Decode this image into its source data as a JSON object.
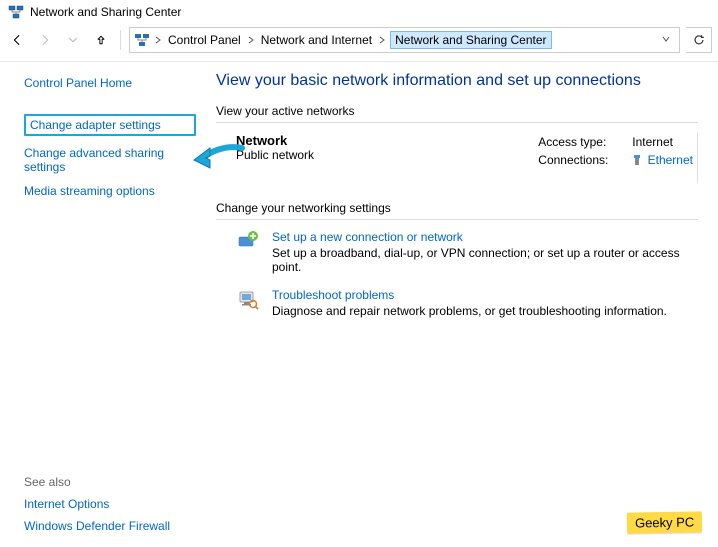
{
  "window": {
    "title": "Network and Sharing Center"
  },
  "breadcrumb": {
    "items": [
      "Control Panel",
      "Network and Internet",
      "Network and Sharing Center"
    ]
  },
  "sidebar": {
    "home": "Control Panel Home",
    "items": [
      "Change adapter settings",
      "Change advanced sharing settings",
      "Media streaming options"
    ]
  },
  "main": {
    "title": "View your basic network information and set up connections",
    "active_networks_label": "View your active networks",
    "network": {
      "name": "Network",
      "type": "Public network",
      "access_label": "Access type:",
      "access_value": "Internet",
      "connections_label": "Connections:",
      "connections_value": "Ethernet"
    },
    "change_settings_label": "Change your networking settings",
    "settings": [
      {
        "title": "Set up a new connection or network",
        "desc": "Set up a broadband, dial-up, or VPN connection; or set up a router or access point."
      },
      {
        "title": "Troubleshoot problems",
        "desc": "Diagnose and repair network problems, or get troubleshooting information."
      }
    ]
  },
  "see_also": {
    "label": "See also",
    "items": [
      "Internet Options",
      "Windows Defender Firewall"
    ]
  },
  "watermark": "Geeky PC"
}
